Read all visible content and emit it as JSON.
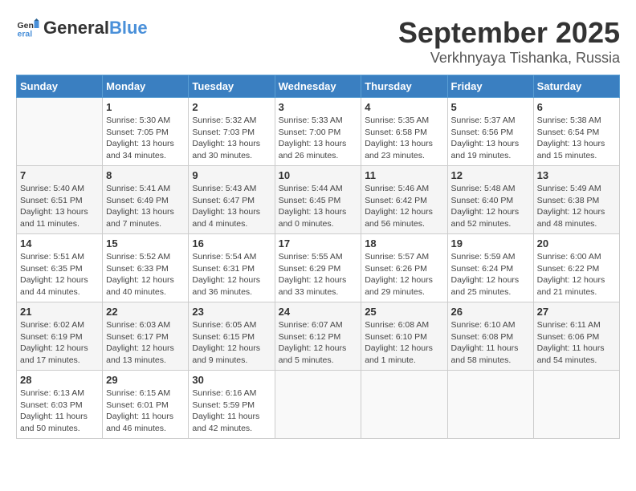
{
  "header": {
    "logo_general": "General",
    "logo_blue": "Blue",
    "month": "September 2025",
    "location": "Verkhnyaya Tishanka, Russia"
  },
  "weekdays": [
    "Sunday",
    "Monday",
    "Tuesday",
    "Wednesday",
    "Thursday",
    "Friday",
    "Saturday"
  ],
  "weeks": [
    [
      {
        "day": null
      },
      {
        "day": "1",
        "sunrise": "5:30 AM",
        "sunset": "7:05 PM",
        "daylight": "13 hours and 34 minutes."
      },
      {
        "day": "2",
        "sunrise": "5:32 AM",
        "sunset": "7:03 PM",
        "daylight": "13 hours and 30 minutes."
      },
      {
        "day": "3",
        "sunrise": "5:33 AM",
        "sunset": "7:00 PM",
        "daylight": "13 hours and 26 minutes."
      },
      {
        "day": "4",
        "sunrise": "5:35 AM",
        "sunset": "6:58 PM",
        "daylight": "13 hours and 23 minutes."
      },
      {
        "day": "5",
        "sunrise": "5:37 AM",
        "sunset": "6:56 PM",
        "daylight": "13 hours and 19 minutes."
      },
      {
        "day": "6",
        "sunrise": "5:38 AM",
        "sunset": "6:54 PM",
        "daylight": "13 hours and 15 minutes."
      }
    ],
    [
      {
        "day": "7",
        "sunrise": "5:40 AM",
        "sunset": "6:51 PM",
        "daylight": "13 hours and 11 minutes."
      },
      {
        "day": "8",
        "sunrise": "5:41 AM",
        "sunset": "6:49 PM",
        "daylight": "13 hours and 7 minutes."
      },
      {
        "day": "9",
        "sunrise": "5:43 AM",
        "sunset": "6:47 PM",
        "daylight": "13 hours and 4 minutes."
      },
      {
        "day": "10",
        "sunrise": "5:44 AM",
        "sunset": "6:45 PM",
        "daylight": "13 hours and 0 minutes."
      },
      {
        "day": "11",
        "sunrise": "5:46 AM",
        "sunset": "6:42 PM",
        "daylight": "12 hours and 56 minutes."
      },
      {
        "day": "12",
        "sunrise": "5:48 AM",
        "sunset": "6:40 PM",
        "daylight": "12 hours and 52 minutes."
      },
      {
        "day": "13",
        "sunrise": "5:49 AM",
        "sunset": "6:38 PM",
        "daylight": "12 hours and 48 minutes."
      }
    ],
    [
      {
        "day": "14",
        "sunrise": "5:51 AM",
        "sunset": "6:35 PM",
        "daylight": "12 hours and 44 minutes."
      },
      {
        "day": "15",
        "sunrise": "5:52 AM",
        "sunset": "6:33 PM",
        "daylight": "12 hours and 40 minutes."
      },
      {
        "day": "16",
        "sunrise": "5:54 AM",
        "sunset": "6:31 PM",
        "daylight": "12 hours and 36 minutes."
      },
      {
        "day": "17",
        "sunrise": "5:55 AM",
        "sunset": "6:29 PM",
        "daylight": "12 hours and 33 minutes."
      },
      {
        "day": "18",
        "sunrise": "5:57 AM",
        "sunset": "6:26 PM",
        "daylight": "12 hours and 29 minutes."
      },
      {
        "day": "19",
        "sunrise": "5:59 AM",
        "sunset": "6:24 PM",
        "daylight": "12 hours and 25 minutes."
      },
      {
        "day": "20",
        "sunrise": "6:00 AM",
        "sunset": "6:22 PM",
        "daylight": "12 hours and 21 minutes."
      }
    ],
    [
      {
        "day": "21",
        "sunrise": "6:02 AM",
        "sunset": "6:19 PM",
        "daylight": "12 hours and 17 minutes."
      },
      {
        "day": "22",
        "sunrise": "6:03 AM",
        "sunset": "6:17 PM",
        "daylight": "12 hours and 13 minutes."
      },
      {
        "day": "23",
        "sunrise": "6:05 AM",
        "sunset": "6:15 PM",
        "daylight": "12 hours and 9 minutes."
      },
      {
        "day": "24",
        "sunrise": "6:07 AM",
        "sunset": "6:12 PM",
        "daylight": "12 hours and 5 minutes."
      },
      {
        "day": "25",
        "sunrise": "6:08 AM",
        "sunset": "6:10 PM",
        "daylight": "12 hours and 1 minute."
      },
      {
        "day": "26",
        "sunrise": "6:10 AM",
        "sunset": "6:08 PM",
        "daylight": "11 hours and 58 minutes."
      },
      {
        "day": "27",
        "sunrise": "6:11 AM",
        "sunset": "6:06 PM",
        "daylight": "11 hours and 54 minutes."
      }
    ],
    [
      {
        "day": "28",
        "sunrise": "6:13 AM",
        "sunset": "6:03 PM",
        "daylight": "11 hours and 50 minutes."
      },
      {
        "day": "29",
        "sunrise": "6:15 AM",
        "sunset": "6:01 PM",
        "daylight": "11 hours and 46 minutes."
      },
      {
        "day": "30",
        "sunrise": "6:16 AM",
        "sunset": "5:59 PM",
        "daylight": "11 hours and 42 minutes."
      },
      {
        "day": null
      },
      {
        "day": null
      },
      {
        "day": null
      },
      {
        "day": null
      }
    ]
  ]
}
